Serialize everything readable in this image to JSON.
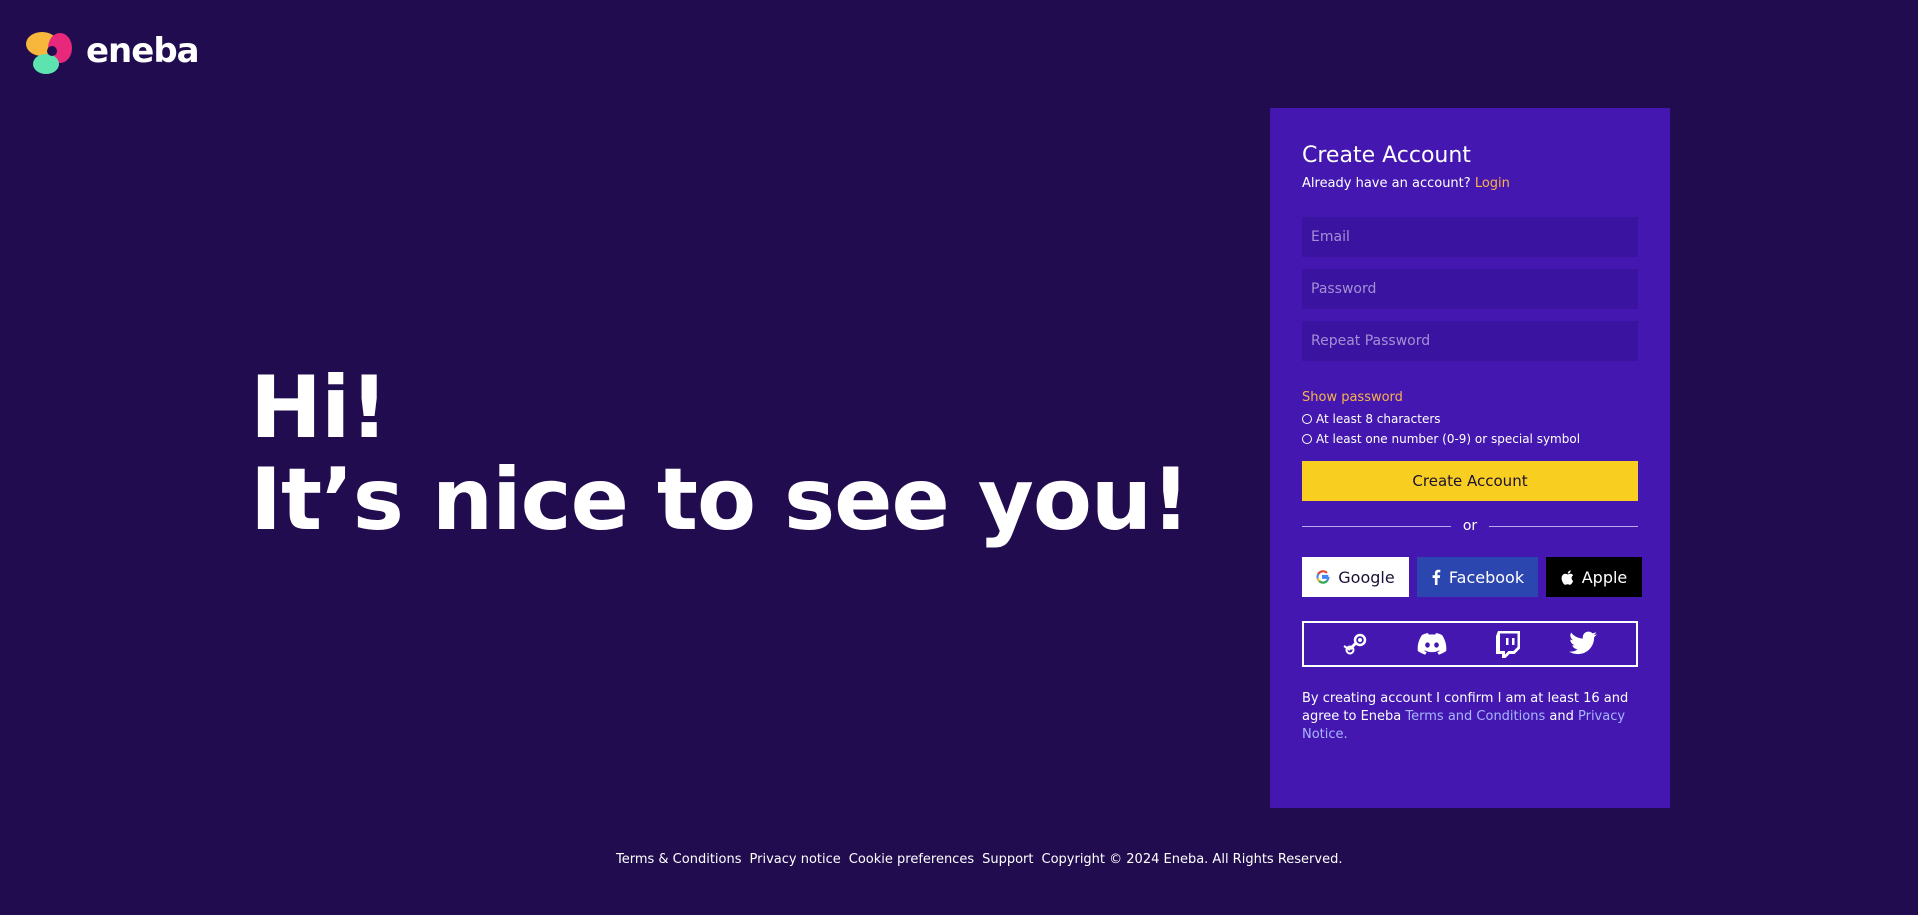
{
  "brand": {
    "name": "eneba"
  },
  "hero": {
    "line1": "Hi!",
    "line2": "It’s nice to see you!"
  },
  "form": {
    "title": "Create Account",
    "already_text": "Already have an account?",
    "login_link": "Login",
    "email_placeholder": "Email",
    "password_placeholder": "Password",
    "repeat_password_placeholder": "Repeat Password",
    "show_password": "Show password",
    "rules": [
      "At least 8 characters",
      "At least one number (0-9) or special symbol"
    ],
    "submit_label": "Create Account",
    "or_label": "or",
    "social": {
      "google": "Google",
      "facebook": "Facebook",
      "apple": "Apple"
    },
    "other_icons": [
      "steam-icon",
      "discord-icon",
      "twitch-icon",
      "twitter-icon"
    ],
    "legal": {
      "prefix": "By creating account I confirm I am at least 16 and agree to Eneba",
      "terms_link": "Terms and Conditions",
      "and": "and",
      "privacy_link": "Privacy Notice."
    }
  },
  "footer": {
    "links": [
      "Terms & Conditions",
      "Privacy notice",
      "Cookie preferences",
      "Support"
    ],
    "copyright": "Copyright © 2024 Eneba. All Rights Reserved."
  },
  "colors": {
    "background": "#200c4f",
    "panel": "#4418b0",
    "input": "#3a14a0",
    "accent_yellow": "#f8cf20",
    "link_orange": "#f9b44a",
    "link_blue": "#a8b6ff",
    "facebook": "#2c46b0"
  }
}
